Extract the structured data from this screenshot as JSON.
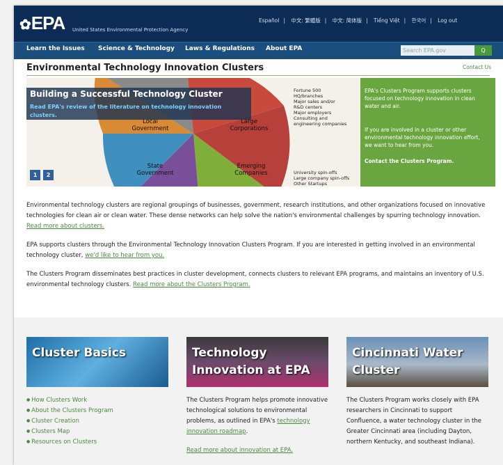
{
  "header": {
    "logo_text": "EPA",
    "agency_name": "United States Environmental Protection Agency",
    "languages": [
      "Español",
      "中文: 繁體版",
      "中文: 简体版",
      "Tiếng Việt",
      "한국어",
      "Log out"
    ],
    "separator": "|"
  },
  "nav": {
    "items": [
      "Learn the Issues",
      "Science & Technology",
      "Laws & Regulations",
      "About EPA"
    ],
    "search_placeholder": "Search EPA.gov",
    "search_button": "Q"
  },
  "page": {
    "title": "Environmental Technology Innovation Clusters",
    "contact_link": "Contact Us"
  },
  "hero": {
    "title": "Building a Successful Technology Cluster",
    "subtitle": "Read EPA's review of the literature on technology innovation clusters.",
    "pie_labels": [
      "Local Government",
      "Large Corporations",
      "State Government",
      "Emerging Companies"
    ],
    "right_bullets": [
      "Fortune 500",
      "HQ/branches",
      "Major sales and/or",
      "R&D centers",
      "Major employers",
      "Consulting and",
      "engineering companies"
    ],
    "lower_bullets": [
      "University spin-offs",
      "Large company spin-offs",
      "Other Startups"
    ],
    "pagers": [
      "1",
      "2"
    ],
    "colors": {
      "pie_red": "#c74a3d",
      "pie_orange": "#d98a35",
      "pie_blue": "#3f8fbf",
      "pie_green": "#7faf3a",
      "pie_purple": "#7a4f9a",
      "pie_gray": "#8a8a8a"
    }
  },
  "side_panel": {
    "text1": "EPA's Clusters Program supports clusters focused on technology innovation in clean water and air.",
    "text2": "If you are involved in a cluster or other environmental technology innovation effort, we want to hear from you.",
    "cta": "Contact the Clusters Program."
  },
  "intro": {
    "p1": "Environmental technology clusters are regional groupings of businesses, government, research institutions, and other organizations focused on innovative technologies for clean air or clean water. These dense networks can help solve the nation's environmental challenges by spurring technology innovation.",
    "p1_link": "Read more about clusters.",
    "p2": "EPA supports clusters through the Environmental Technology Innovation Clusters Program. If you are interested in getting involved in an environmental technology cluster,",
    "p2_link": "we'd like to hear from you.",
    "p3": "The Clusters Program disseminates best practices in cluster development, connects clusters to relevant EPA programs, and maintains an inventory of U.S. environmental technology clusters.",
    "p3_link": "Read more about the Clusters Program."
  },
  "columns": {
    "basics": {
      "title": "Cluster Basics",
      "links": [
        "How Clusters Work",
        "About the Clusters Program",
        "Cluster Creation",
        "Clusters Map",
        "Resources on Clusters"
      ]
    },
    "innovation": {
      "title_line1": "Technology",
      "title_line2": "Innovation at EPA",
      "text": "The Clusters Program helps promote innovative technological solutions to environmental problems, as outlined in EPA's",
      "link": "technology innovation roadmap",
      "link2": "Read more about innovation at EPA."
    },
    "cincinnati": {
      "title_line1": "Cincinnati Water",
      "title_line2": "Cluster",
      "text": "The Clusters Program works closely with EPA researchers in Cincinnati to support Confluence, a water technology cluster in the Greater Cincinnati area (including Dayton, northern Kentucky, and southeast Indiana)."
    }
  }
}
